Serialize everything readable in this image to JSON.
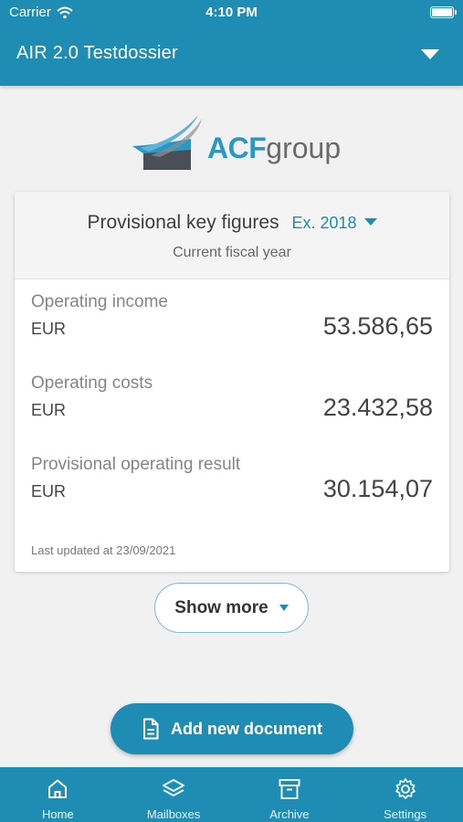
{
  "status_bar": {
    "carrier": "Carrier",
    "time": "4:10 PM"
  },
  "header": {
    "title": "AIR 2.0 Testdossier"
  },
  "logo": {
    "brand": "ACF",
    "suffix": "group"
  },
  "key_figures": {
    "title": "Provisional key figures",
    "year": "Ex. 2018",
    "subtitle": "Current fiscal year",
    "metrics": [
      {
        "label": "Operating income",
        "currency": "EUR",
        "value": "53.586,65"
      },
      {
        "label": "Operating costs",
        "currency": "EUR",
        "value": "23.432,58"
      },
      {
        "label": "Provisional operating result",
        "currency": "EUR",
        "value": "30.154,07"
      }
    ],
    "last_updated": "Last updated at 23/09/2021"
  },
  "show_more": {
    "label": "Show more"
  },
  "add_document": {
    "label": "Add new document"
  },
  "tabs": [
    {
      "label": "Home",
      "icon": "home-icon",
      "active": true
    },
    {
      "label": "Mailboxes",
      "icon": "layers-icon",
      "active": false
    },
    {
      "label": "Archive",
      "icon": "archive-icon",
      "active": false
    },
    {
      "label": "Settings",
      "icon": "gear-icon",
      "active": false
    }
  ],
  "colors": {
    "accent": "#1f8cb3",
    "background": "#f1f1f1"
  }
}
